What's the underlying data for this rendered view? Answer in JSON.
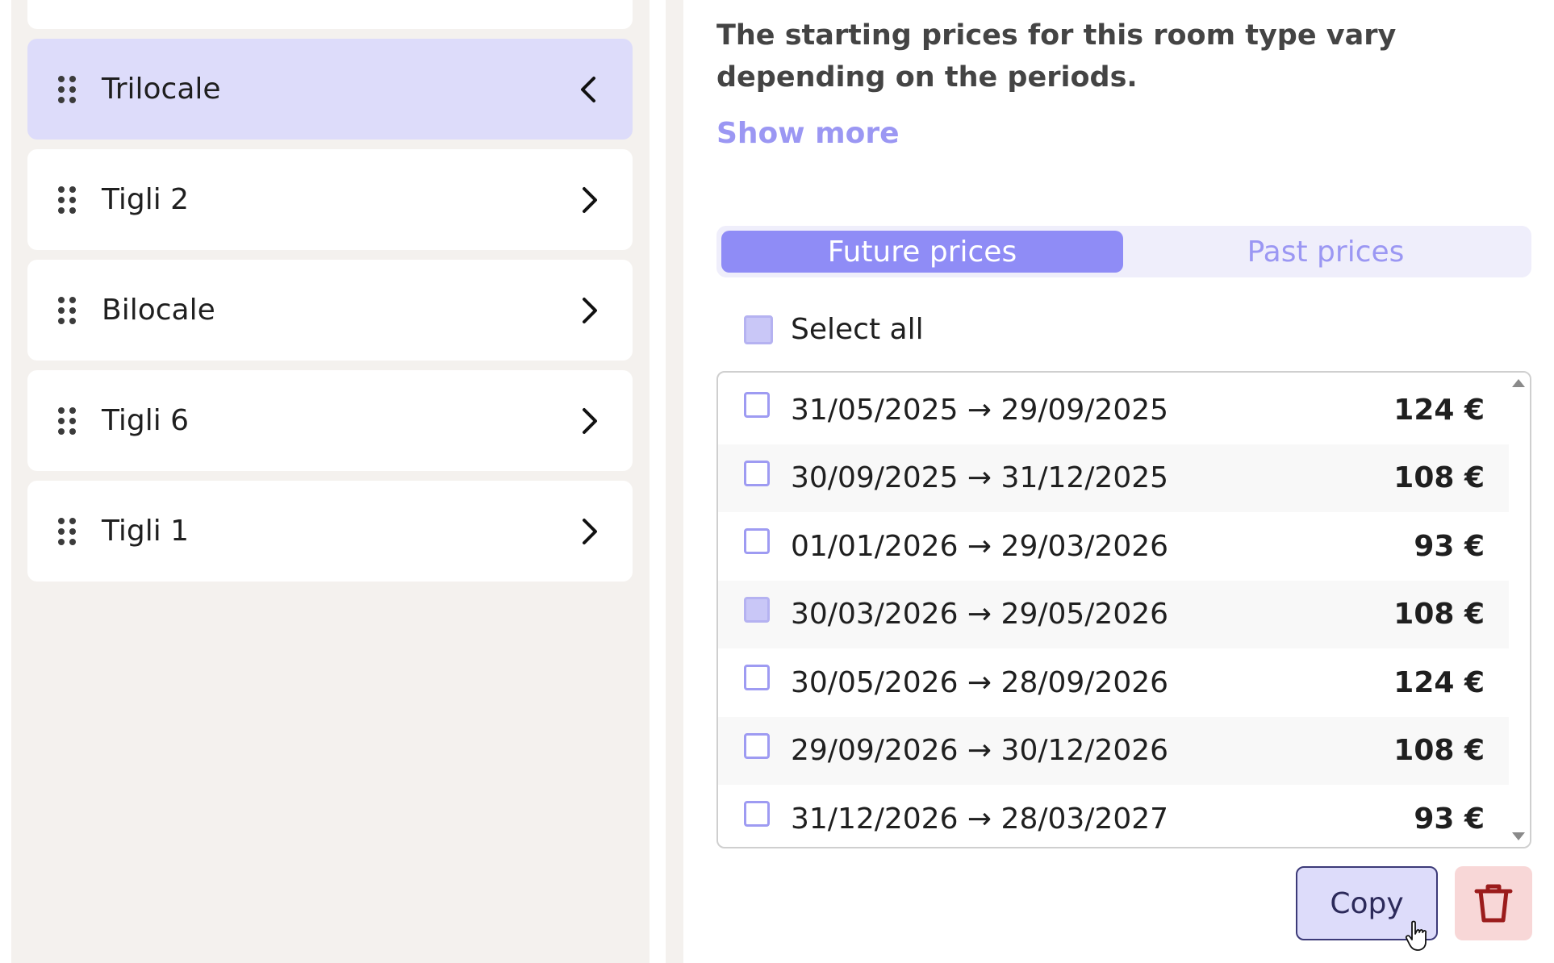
{
  "rooms": [
    {
      "label": "Trilocale",
      "active": true
    },
    {
      "label": "Tigli 2",
      "active": false
    },
    {
      "label": "Bilocale",
      "active": false
    },
    {
      "label": "Tigli 6",
      "active": false
    },
    {
      "label": "Tigli 1",
      "active": false
    }
  ],
  "description": "The starting prices for this room type vary depending on the periods.",
  "show_more": "Show more",
  "tabs": {
    "future": "Future prices",
    "past": "Past prices"
  },
  "select_all": "Select all",
  "prices": [
    {
      "period": "31/05/2025 → 29/09/2025",
      "price": "124 €",
      "checked": false
    },
    {
      "period": "30/09/2025 → 31/12/2025",
      "price": "108 €",
      "checked": false
    },
    {
      "period": "01/01/2026 → 29/03/2026",
      "price": "93 €",
      "checked": false
    },
    {
      "period": "30/03/2026 → 29/05/2026",
      "price": "108 €",
      "checked": true
    },
    {
      "period": "30/05/2026 → 28/09/2026",
      "price": "124 €",
      "checked": false
    },
    {
      "period": "29/09/2026 → 30/12/2026",
      "price": "108 €",
      "checked": false
    },
    {
      "period": "31/12/2026 → 28/03/2027",
      "price": "93 €",
      "checked": false
    }
  ],
  "actions": {
    "copy": "Copy"
  },
  "colors": {
    "accent": "#8f8cf6",
    "active_room": "#dddcfa",
    "delete_bg": "#f8d7d7",
    "delete_icon": "#9b1c1c"
  }
}
